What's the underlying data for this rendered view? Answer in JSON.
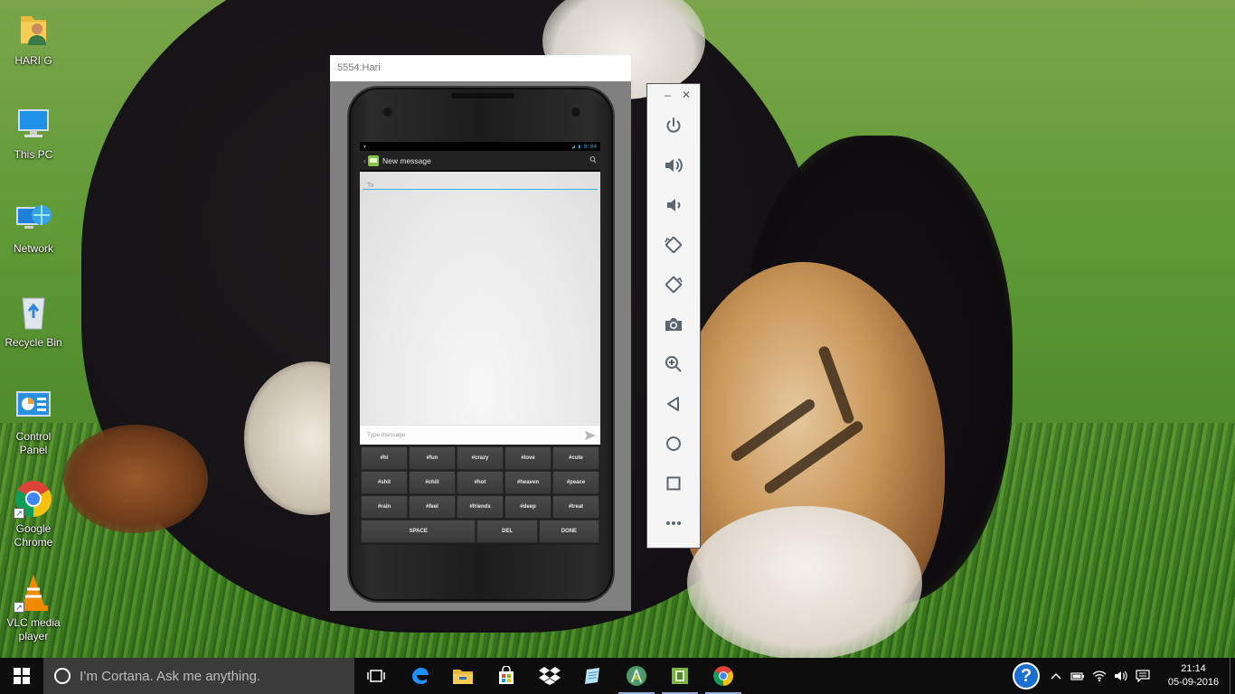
{
  "desktop": {
    "icons": [
      {
        "label": "HARI G",
        "icon": "user-folder-icon"
      },
      {
        "label": "This PC",
        "icon": "computer-icon"
      },
      {
        "label": "Network",
        "icon": "network-icon"
      },
      {
        "label": "Recycle Bin",
        "icon": "recycle-bin-icon"
      },
      {
        "label": "Control Panel",
        "icon": "control-panel-icon"
      },
      {
        "label": "Google Chrome",
        "icon": "chrome-icon"
      },
      {
        "label": "VLC media player",
        "icon": "vlc-icon"
      }
    ]
  },
  "emulator": {
    "window_title": "5554:Hari",
    "status_time": "9:04",
    "app_title": "New message",
    "to_placeholder": "To",
    "message_placeholder": "Type message",
    "keyboard": {
      "rows": [
        [
          "#hi",
          "#fun",
          "#crazy",
          "#love",
          "#cute"
        ],
        [
          "#shit",
          "#chill",
          "#hot",
          "#heaven",
          "#peace"
        ],
        [
          "#rain",
          "#feel",
          "#friends",
          "#deep",
          "#treat"
        ]
      ],
      "space": "SPACE",
      "del": "DEL",
      "done": "DONE"
    },
    "toolbar": {
      "minimize": "–",
      "close": "✕",
      "buttons": [
        "power-icon",
        "volume-up-icon",
        "volume-down-icon",
        "rotate-left-icon",
        "rotate-right-icon",
        "camera-icon",
        "zoom-icon",
        "back-icon",
        "home-icon",
        "overview-icon",
        "more-icon"
      ]
    }
  },
  "taskbar": {
    "search_placeholder": "I’m Cortana. Ask me anything.",
    "apps": [
      "task-view-icon",
      "edge-icon",
      "file-explorer-icon",
      "store-icon",
      "dropbox-icon",
      "notepad-icon",
      "android-studio-icon",
      "bluestacks-icon",
      "chrome-icon"
    ],
    "clock_time": "21:14",
    "clock_date": "05-09-2016",
    "help": "?"
  },
  "colors": {
    "accent": "#33b5e5",
    "taskbar": "#0d0d0d",
    "cortana_box": "#3b3b3b"
  }
}
